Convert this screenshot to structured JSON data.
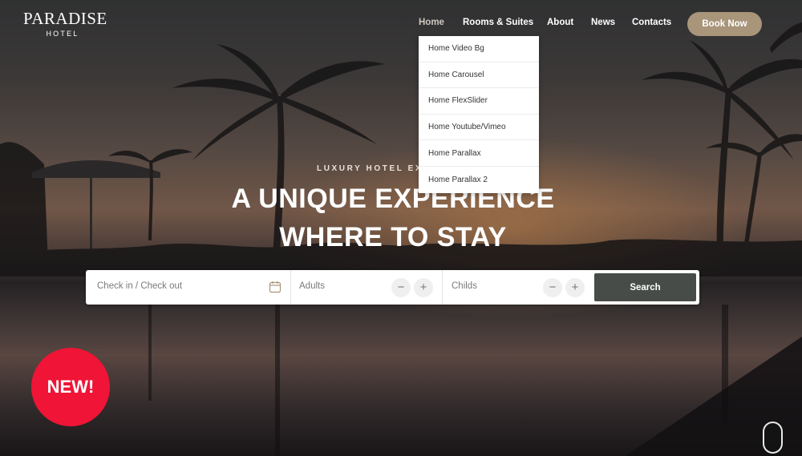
{
  "logo": {
    "main": "PARADISE",
    "sub": "HOTEL"
  },
  "nav": {
    "items": [
      {
        "label": "Home"
      },
      {
        "label": "Rooms & Suites"
      },
      {
        "label": "About"
      },
      {
        "label": "News"
      },
      {
        "label": "Contacts"
      }
    ],
    "book_label": "Book Now"
  },
  "dropdown": {
    "items": [
      "Home Video Bg",
      "Home Carousel",
      "Home FlexSlider",
      "Home Youtube/Vimeo",
      "Home Parallax",
      "Home Parallax 2"
    ]
  },
  "hero": {
    "tagline": "LUXURY HOTEL EXP",
    "headline_line1": "A UNIQUE EXPERIENCE",
    "headline_line2": "WHERE TO STAY"
  },
  "booking": {
    "checkin_placeholder": "Check in / Check out",
    "adults_label": "Adults",
    "childs_label": "Childs",
    "minus_symbol": "−",
    "plus_symbol": "+",
    "search_label": "Search"
  },
  "badge": {
    "label": "NEW!"
  },
  "colors": {
    "accent": "#a8957a",
    "search_button": "#474c49",
    "badge": "#f01436"
  }
}
